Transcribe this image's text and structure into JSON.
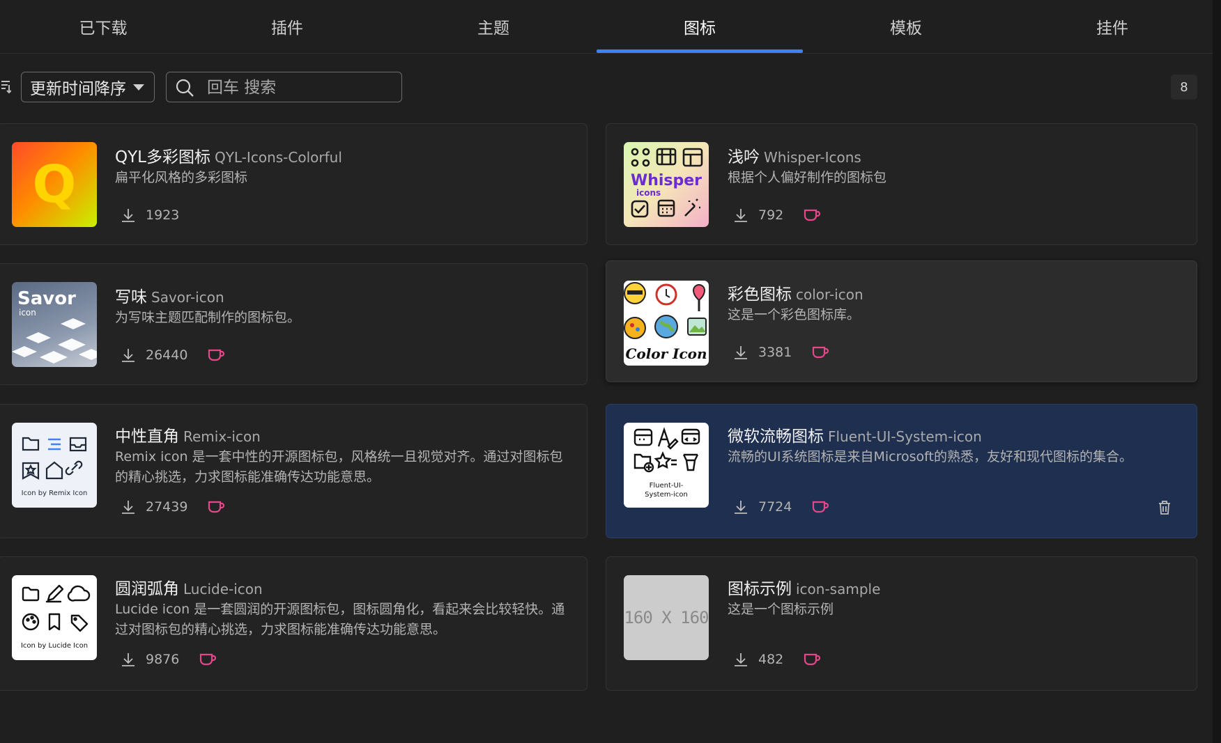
{
  "tabs": [
    "已下载",
    "插件",
    "主题",
    "图标",
    "模板",
    "挂件"
  ],
  "active_tab": "图标",
  "toolbar": {
    "sort_label": "更新时间降序",
    "search_placeholder": "回车 搜索",
    "count": "8"
  },
  "colors": {
    "accent": "#3b82f6",
    "heart": "#e5488a",
    "selected_card": "#1f2f4f"
  },
  "cards": [
    {
      "name": "QYL多彩图标",
      "sub": "QYL-Icons-Colorful",
      "desc": "扁平化风格的多彩图标",
      "downloads": "1923",
      "thumb_text": "Q",
      "has_heart": false
    },
    {
      "name": "浅吟",
      "sub": "Whisper-Icons",
      "desc": "根据个人偏好制作的图标包",
      "downloads": "792",
      "thumb_text": "Whisper",
      "thumb_sub": "icons",
      "has_heart": true
    },
    {
      "name": "写味",
      "sub": "Savor-icon",
      "desc": "为写味主题匹配制作的图标包。",
      "downloads": "26440",
      "thumb_text": "Savor",
      "thumb_sub": "icon",
      "has_heart": true
    },
    {
      "name": "彩色图标",
      "sub": "color-icon",
      "desc": "这是一个彩色图标库。",
      "downloads": "3381",
      "thumb_text": "Color Icon",
      "has_heart": true
    },
    {
      "name": "中性直角",
      "sub": "Remix-icon",
      "desc": "Remix icon 是一套中性的开源图标包，风格统一且视觉对齐。通过对图标包的精心挑选，力求图标能准确传达功能意思。",
      "downloads": "27439",
      "thumb_text": "Icon by Remix Icon",
      "has_heart": true
    },
    {
      "name": "微软流畅图标",
      "sub": "Fluent-UI-System-icon",
      "desc": "流畅的UI系统图标是来自Microsoft的熟悉，友好和现代图标的集合。",
      "downloads": "7724",
      "thumb_text": "Fluent-UI-",
      "thumb_sub": "System-icon",
      "has_heart": true
    },
    {
      "name": "圆润弧角",
      "sub": "Lucide-icon",
      "desc": "Lucide icon 是一套圆润的开源图标包，图标圆角化，看起来会比较轻快。通过对图标包的精心挑选，力求图标能准确传达功能意思。",
      "downloads": "9876",
      "thumb_text": "Icon by Lucide Icon",
      "has_heart": true
    },
    {
      "name": "图标示例",
      "sub": "icon-sample",
      "desc": "这是一个图标示例",
      "downloads": "482",
      "thumb_text": "160 X 160",
      "has_heart": true
    }
  ]
}
